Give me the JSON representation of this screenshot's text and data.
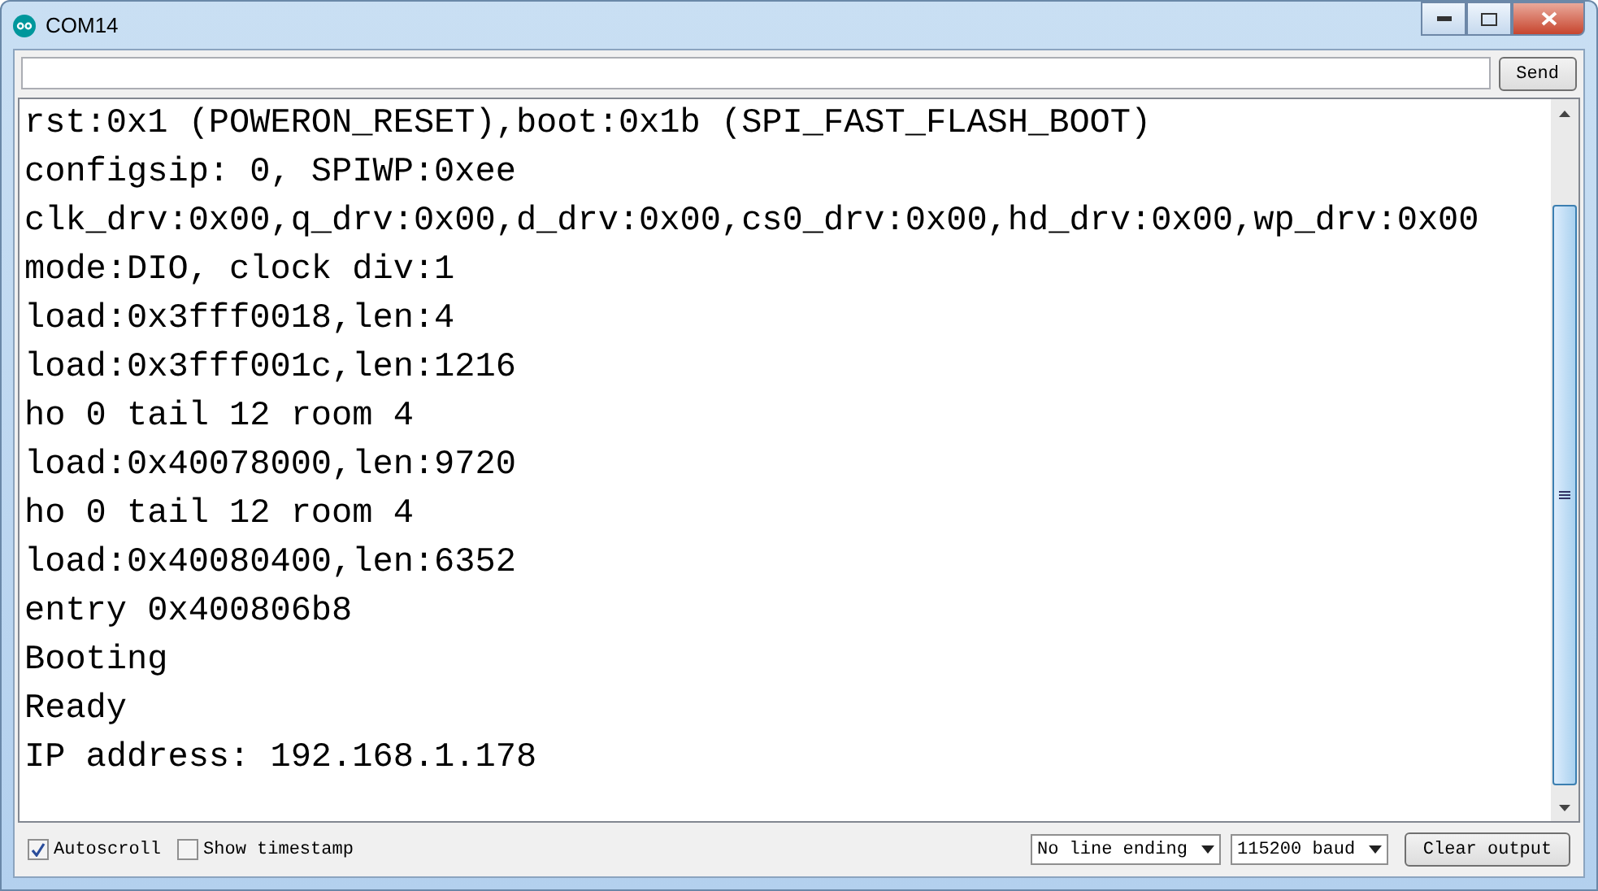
{
  "window": {
    "title": "COM14"
  },
  "send_button": "Send",
  "output_lines": [
    "rst:0x1 (POWERON_RESET),boot:0x1b (SPI_FAST_FLASH_BOOT)",
    "configsip: 0, SPIWP:0xee",
    "clk_drv:0x00,q_drv:0x00,d_drv:0x00,cs0_drv:0x00,hd_drv:0x00,wp_drv:0x00",
    "mode:DIO, clock div:1",
    "load:0x3fff0018,len:4",
    "load:0x3fff001c,len:1216",
    "ho 0 tail 12 room 4",
    "load:0x40078000,len:9720",
    "ho 0 tail 12 room 4",
    "load:0x40080400,len:6352",
    "entry 0x400806b8",
    "Booting",
    "Ready",
    "IP address: 192.168.1.178"
  ],
  "options": [
    {
      "label": "Autoscroll",
      "checked": true
    },
    {
      "label": "Show timestamp",
      "checked": false
    }
  ],
  "line_ending": "No line ending",
  "baud": "115200 baud",
  "clear_button": "Clear output"
}
